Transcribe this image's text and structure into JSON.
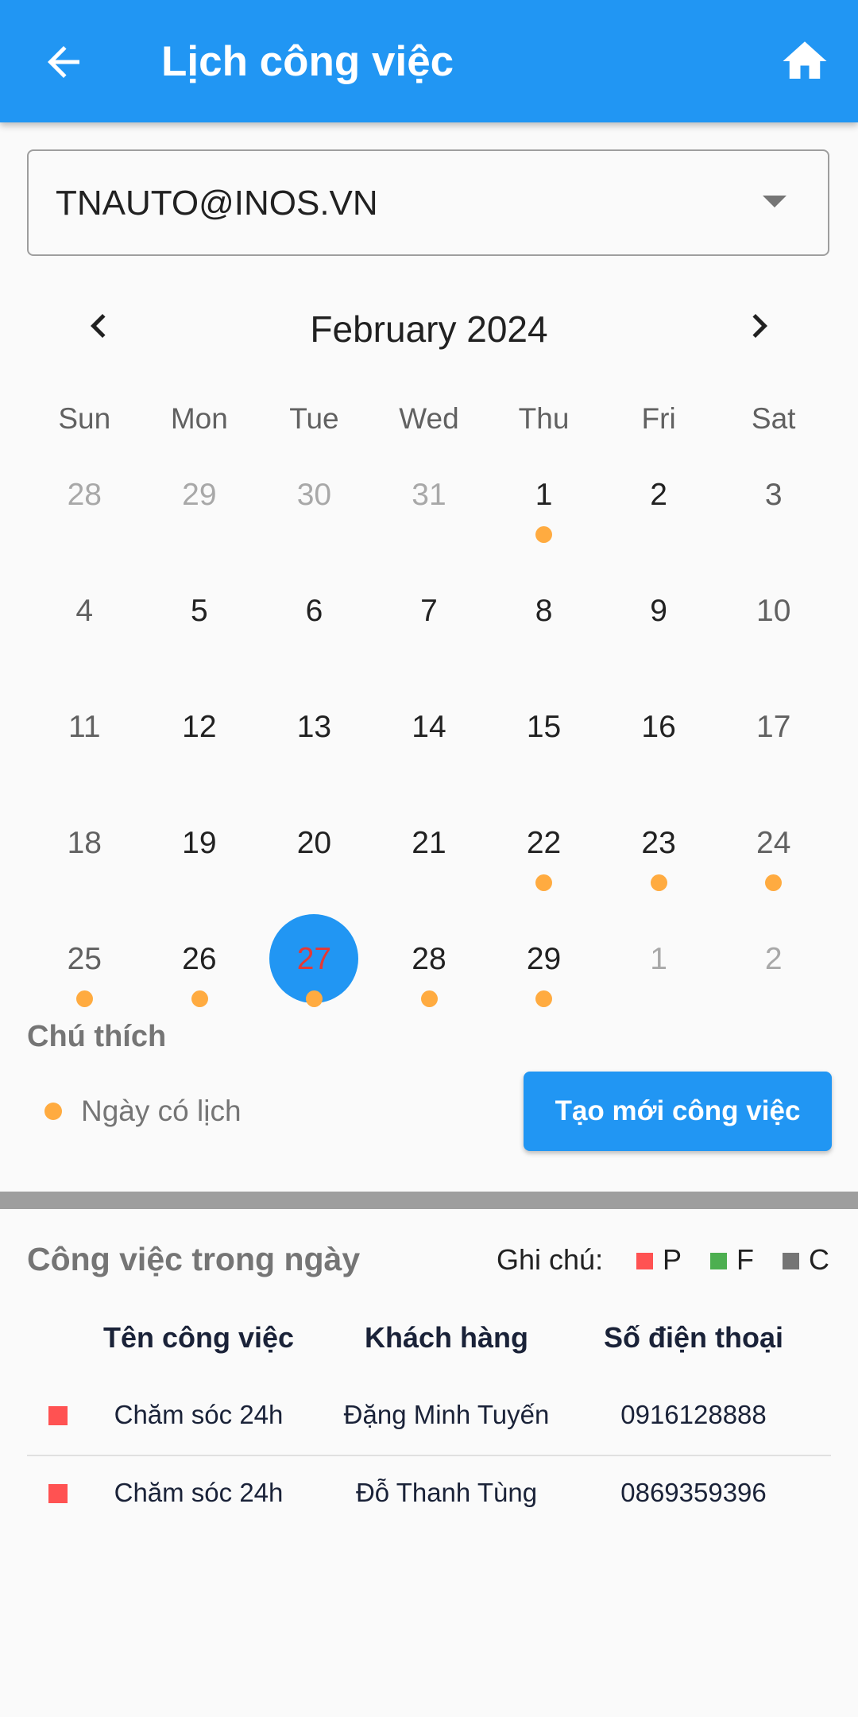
{
  "appbar": {
    "title": "Lịch công việc",
    "back_icon": "arrow-back-icon",
    "home_icon": "home-icon",
    "color": "#2196f3"
  },
  "account": {
    "selected": "TNAUTO@INOS.VN"
  },
  "calendar": {
    "month_label": "February 2024",
    "weekdays": [
      "Sun",
      "Mon",
      "Tue",
      "Wed",
      "Thu",
      "Fri",
      "Sat"
    ],
    "weeks": [
      [
        {
          "day": "28",
          "muted": true,
          "event": false
        },
        {
          "day": "29",
          "muted": true,
          "event": false
        },
        {
          "day": "30",
          "muted": true,
          "event": false
        },
        {
          "day": "31",
          "muted": true,
          "event": false
        },
        {
          "day": "1",
          "muted": false,
          "event": true
        },
        {
          "day": "2",
          "muted": false,
          "event": false
        },
        {
          "day": "3",
          "muted": false,
          "event": false
        }
      ],
      [
        {
          "day": "4",
          "muted": false,
          "event": false
        },
        {
          "day": "5",
          "muted": false,
          "event": false
        },
        {
          "day": "6",
          "muted": false,
          "event": false
        },
        {
          "day": "7",
          "muted": false,
          "event": false
        },
        {
          "day": "8",
          "muted": false,
          "event": false
        },
        {
          "day": "9",
          "muted": false,
          "event": false
        },
        {
          "day": "10",
          "muted": false,
          "event": false
        }
      ],
      [
        {
          "day": "11",
          "muted": false,
          "event": false
        },
        {
          "day": "12",
          "muted": false,
          "event": false
        },
        {
          "day": "13",
          "muted": false,
          "event": false
        },
        {
          "day": "14",
          "muted": false,
          "event": false
        },
        {
          "day": "15",
          "muted": false,
          "event": false
        },
        {
          "day": "16",
          "muted": false,
          "event": false
        },
        {
          "day": "17",
          "muted": false,
          "event": false
        }
      ],
      [
        {
          "day": "18",
          "muted": false,
          "event": false
        },
        {
          "day": "19",
          "muted": false,
          "event": false
        },
        {
          "day": "20",
          "muted": false,
          "event": false
        },
        {
          "day": "21",
          "muted": false,
          "event": false
        },
        {
          "day": "22",
          "muted": false,
          "event": true
        },
        {
          "day": "23",
          "muted": false,
          "event": true
        },
        {
          "day": "24",
          "muted": false,
          "event": true
        }
      ],
      [
        {
          "day": "25",
          "muted": false,
          "event": true
        },
        {
          "day": "26",
          "muted": false,
          "event": true
        },
        {
          "day": "27",
          "muted": false,
          "event": true,
          "selected": true
        },
        {
          "day": "28",
          "muted": false,
          "event": true
        },
        {
          "day": "29",
          "muted": false,
          "event": true
        },
        {
          "day": "1",
          "muted": true,
          "event": false
        },
        {
          "day": "2",
          "muted": true,
          "event": false
        }
      ]
    ],
    "event_dot_color": "#ffab40",
    "selected_color": "#2196f3",
    "selected_text_color": "#e53935"
  },
  "legend": {
    "title": "Chú thích",
    "item_label": "Ngày có lịch"
  },
  "create_button": {
    "label": "Tạo mới công việc"
  },
  "tasks": {
    "title": "Công việc trong ngày",
    "note_label": "Ghi chú:",
    "status_keys": [
      {
        "label": "P",
        "color": "#ff5252"
      },
      {
        "label": "F",
        "color": "#4caf50"
      },
      {
        "label": "C",
        "color": "#757575"
      }
    ],
    "columns": [
      "Tên công việc",
      "Khách hàng",
      "Số điện thoại"
    ],
    "rows": [
      {
        "status": "P",
        "name": "Chăm sóc 24h",
        "customer": "Đặng Minh Tuyến",
        "phone": "0916128888"
      },
      {
        "status": "P",
        "name": "Chăm sóc 24h",
        "customer": "Đỗ Thanh Tùng",
        "phone": "0869359396"
      }
    ]
  }
}
